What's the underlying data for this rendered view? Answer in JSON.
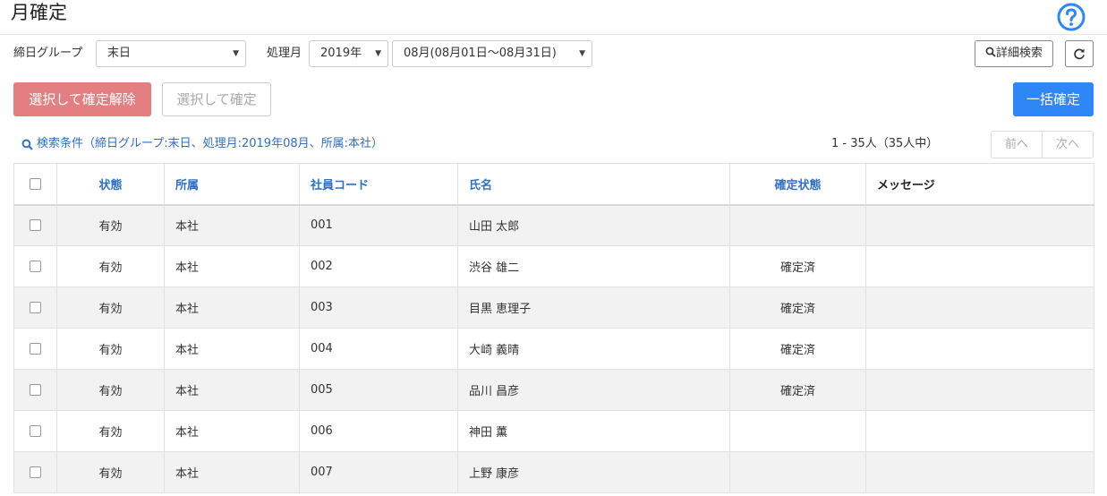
{
  "page": {
    "title": "月確定"
  },
  "filters": {
    "closing_group_label": "締日グループ",
    "closing_group_value": "末日",
    "month_label": "処理月",
    "year_value": "2019年",
    "month_value": "08月(08月01日～08月31日)",
    "detail_search": "詳細検索"
  },
  "actions": {
    "cancel_selected": "選択して確定解除",
    "confirm_selected": "選択して確定",
    "bulk_confirm": "一括確定"
  },
  "search": {
    "condition": "検索条件（締日グループ:末日、処理月:2019年08月、所属:本社）"
  },
  "pagination": {
    "range": "1 - 35人（35人中）",
    "prev": "前へ",
    "next": "次へ"
  },
  "table": {
    "headers": [
      "状態",
      "所属",
      "社員コード",
      "氏名",
      "確定状態",
      "メッセージ"
    ],
    "rows": [
      [
        "有効",
        "本社",
        "001",
        "山田 太郎",
        "",
        ""
      ],
      [
        "有効",
        "本社",
        "002",
        "渋谷 雄二",
        "確定済",
        ""
      ],
      [
        "有効",
        "本社",
        "003",
        "目黒 恵理子",
        "確定済",
        ""
      ],
      [
        "有効",
        "本社",
        "004",
        "大崎 義晴",
        "確定済",
        ""
      ],
      [
        "有効",
        "本社",
        "005",
        "品川 昌彦",
        "確定済",
        ""
      ],
      [
        "有効",
        "本社",
        "006",
        "神田 薫",
        "",
        ""
      ],
      [
        "有効",
        "本社",
        "007",
        "上野 康彦",
        "",
        ""
      ]
    ]
  },
  "colors": {
    "accent": "#2f86f6",
    "danger": "#e47f81",
    "link": "#2f6fc4"
  }
}
